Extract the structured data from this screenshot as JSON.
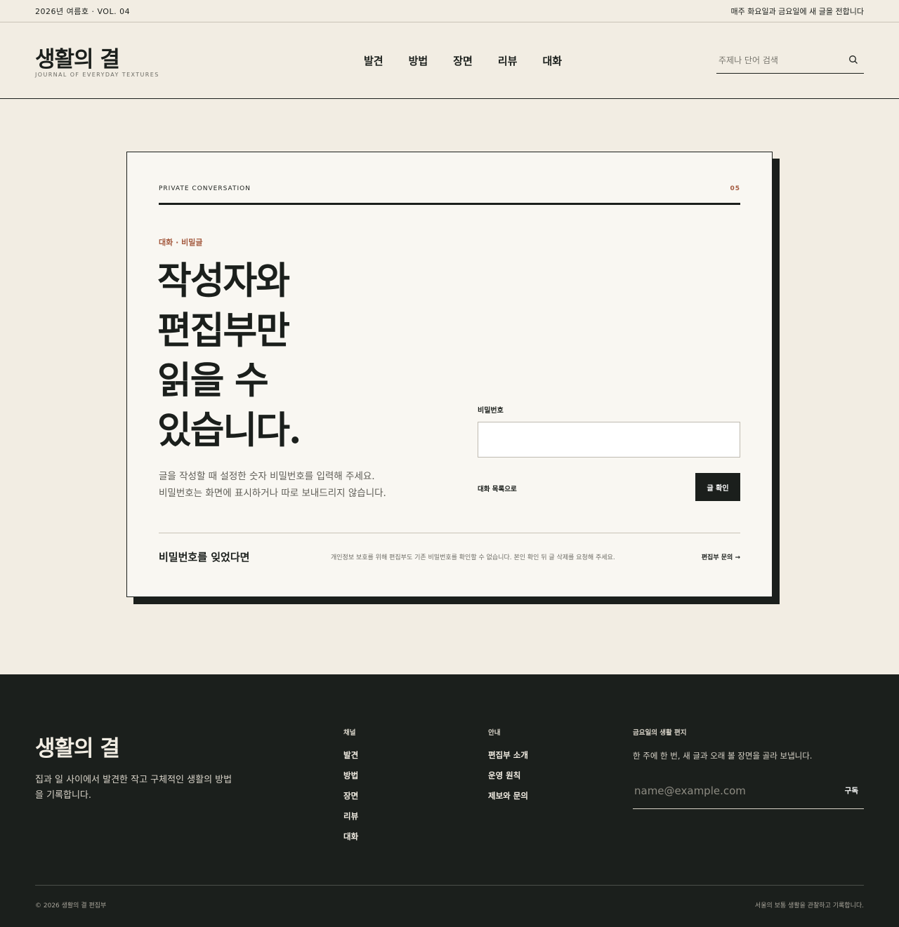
{
  "topbar": {
    "issue": "2026년 여름호 · VOL. 04",
    "notice": "매주 화요일과 금요일에 새 글을 전합니다"
  },
  "header": {
    "logo": "생활의 결",
    "logo_sub": "JOURNAL OF EVERYDAY TEXTURES",
    "nav": [
      "발견",
      "방법",
      "장면",
      "리뷰",
      "대화"
    ],
    "search_placeholder": "주제나 단어 검색",
    "search_icon": "search-icon"
  },
  "card": {
    "kicker": "PRIVATE CONVERSATION",
    "kicker_num": "05",
    "category": "대화 · 비밀글",
    "title_lines": [
      "작성자와",
      "편집부만",
      "읽을 수",
      "있습니다."
    ],
    "desc_lines": [
      "글을 작성할 때 설정한 숫자 비밀번호를 입력해 주세요.",
      "비밀번호는 화면에 표시하거나 따로 보내드리지 않습니다."
    ],
    "password_label": "비밀번호",
    "password_value": "",
    "back_link": "대화 목록으로",
    "submit_label": "글 확인",
    "forgot_title": "비밀번호를 잊었다면",
    "forgot_desc": "개인정보 보호를 위해 편집부도 기존 비밀번호를 확인할 수 없습니다. 본인 확인 뒤 글 삭제를 요청해 주세요.",
    "contact_link": "편집부 문의 →"
  },
  "footer": {
    "logo": "생활의 결",
    "tagline": "집과 일 사이에서 발견한 작고 구체적인 생활의 방법을 기록합니다.",
    "channel_head": "채널",
    "channel_links": [
      "발견",
      "방법",
      "장면",
      "리뷰",
      "대화"
    ],
    "guide_head": "안내",
    "guide_links": [
      "편집부 소개",
      "운영 원칙",
      "제보와 문의"
    ],
    "newsletter_head": "금요일의 생활 편지",
    "newsletter_desc": "한 주에 한 번, 새 글과 오래 볼 장면을 골라 보냅니다.",
    "email_placeholder": "name@example.com",
    "subscribe_label": "구독",
    "copyright": "© 2026 생활의 결 편집부",
    "motto": "서울의 보통 생활을 관찰하고 기록합니다."
  },
  "colors": {
    "background": "#f2ede3",
    "ink": "#1b1f1c",
    "accent": "#a45a3f",
    "card": "#f9f7f2"
  }
}
